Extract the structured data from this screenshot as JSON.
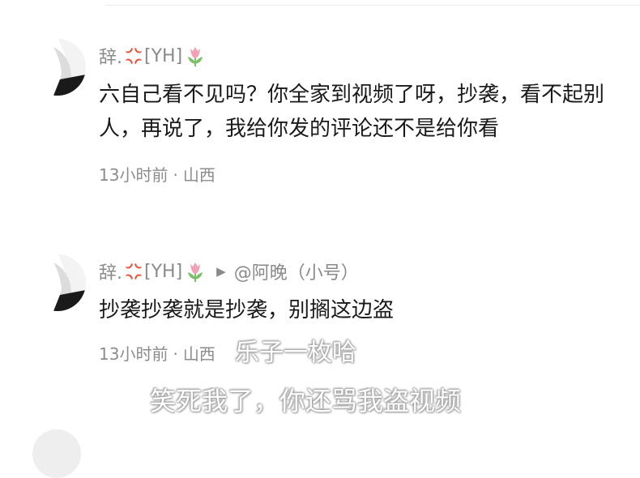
{
  "comments": [
    {
      "username": "辞.",
      "username_tag": "[YH]",
      "text": "六自己看不见吗？你全家到视频了呀，抄袭，看不起别人，再说了，我给你发的评论还不是给你看",
      "time": "13小时前",
      "dot": "·",
      "location": "山西"
    },
    {
      "username": "辞.",
      "username_tag": "[YH]",
      "reply_to": "@阿晚（小号）",
      "text": "抄袭抄袭就是抄袭，别搁这边盗",
      "time": "13小时前",
      "dot": "·",
      "location": "山西"
    }
  ],
  "overlay_captions": [
    "乐子一枚哈",
    "笑死我了，你还骂我盗视频"
  ],
  "icons": {
    "anger": "anger-icon",
    "tulip": "tulip-icon",
    "reply_arrow": "play-arrow-icon"
  },
  "colors": {
    "meta_gray": "#8a8a8a",
    "text": "#1a1a1a",
    "anger_red": "#e8553a",
    "tulip_pink": "#f1a2b4",
    "tulip_green": "#7cbf6a"
  }
}
